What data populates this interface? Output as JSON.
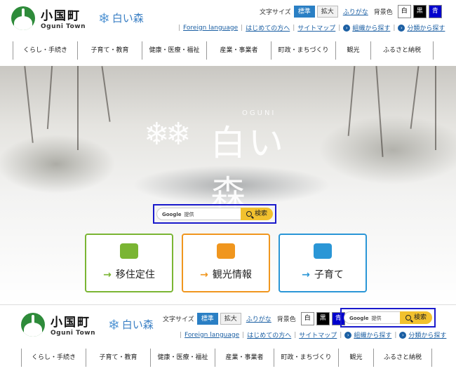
{
  "logo": {
    "name_jp": "小国町",
    "name_en": "Oguni Town",
    "brand": "白い森"
  },
  "util": {
    "fontsize_label": "文字サイズ",
    "standard": "標準",
    "enlarge": "拡大",
    "furigana": "ふりがな",
    "bgcolor_label": "背景色",
    "bg_white": "白",
    "bg_black": "黒",
    "bg_blue": "青"
  },
  "links": {
    "foreign": "Foreign language",
    "first_time": "はじめての方へ",
    "sitemap": "サイトマップ",
    "by_org": "組織から探す",
    "by_category": "分類から探す"
  },
  "nav": [
    "くらし・手続き",
    "子育て・教育",
    "健康・医療・福祉",
    "産業・事業者",
    "町政・まちづくり",
    "観光",
    "ふるさと納税"
  ],
  "hero": {
    "oguni": "OGUNI",
    "wordmark": "白い森"
  },
  "search": {
    "google": "Google",
    "placeholder": "提供",
    "button": "検索"
  },
  "cards": [
    {
      "label": "移住定住",
      "color": "#7ab533",
      "icon": "house-icon"
    },
    {
      "label": "観光情報",
      "color": "#f0961e",
      "icon": "camera-icon"
    },
    {
      "label": "子育て",
      "color": "#2a96d6",
      "icon": "rocking-horse-icon"
    }
  ]
}
